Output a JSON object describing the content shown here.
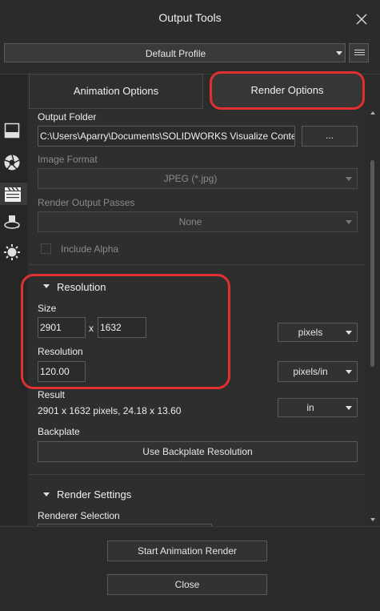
{
  "window": {
    "title": "Output Tools"
  },
  "profile": {
    "selected": "Default Profile"
  },
  "tabs": [
    {
      "label": "Animation Options"
    },
    {
      "label": "Render Options"
    }
  ],
  "output_folder": {
    "label": "Output Folder",
    "value": "C:\\Users\\Aparry\\Documents\\SOLIDWORKS Visualize Content",
    "browse_label": "..."
  },
  "image_format": {
    "label": "Image Format",
    "selected": "JPEG (*.jpg)"
  },
  "render_output_passes": {
    "label": "Render Output Passes",
    "selected": "None"
  },
  "include_alpha": {
    "label": "Include Alpha",
    "checked": false
  },
  "resolution_section": {
    "header": "Resolution",
    "size_label": "Size",
    "width": "2901",
    "times": "x",
    "height": "1632",
    "size_unit": "pixels",
    "resolution_label": "Resolution",
    "resolution_value": "120.00",
    "resolution_unit": "pixels/in",
    "result_label": "Result",
    "result_value": "2901 x 1632 pixels, 24.18 x 13.60",
    "result_unit": "in",
    "backplate_label": "Backplate",
    "backplate_button": "Use Backplate Resolution"
  },
  "render_settings": {
    "header": "Render Settings",
    "renderer_label": "Renderer Selection"
  },
  "footer": {
    "start_label": "Start Animation Render",
    "close_label": "Close"
  },
  "sidebar_icons": [
    "camera-view-icon",
    "aperture-icon",
    "clapperboard-icon",
    "turntable-icon",
    "sun-gear-icon"
  ]
}
